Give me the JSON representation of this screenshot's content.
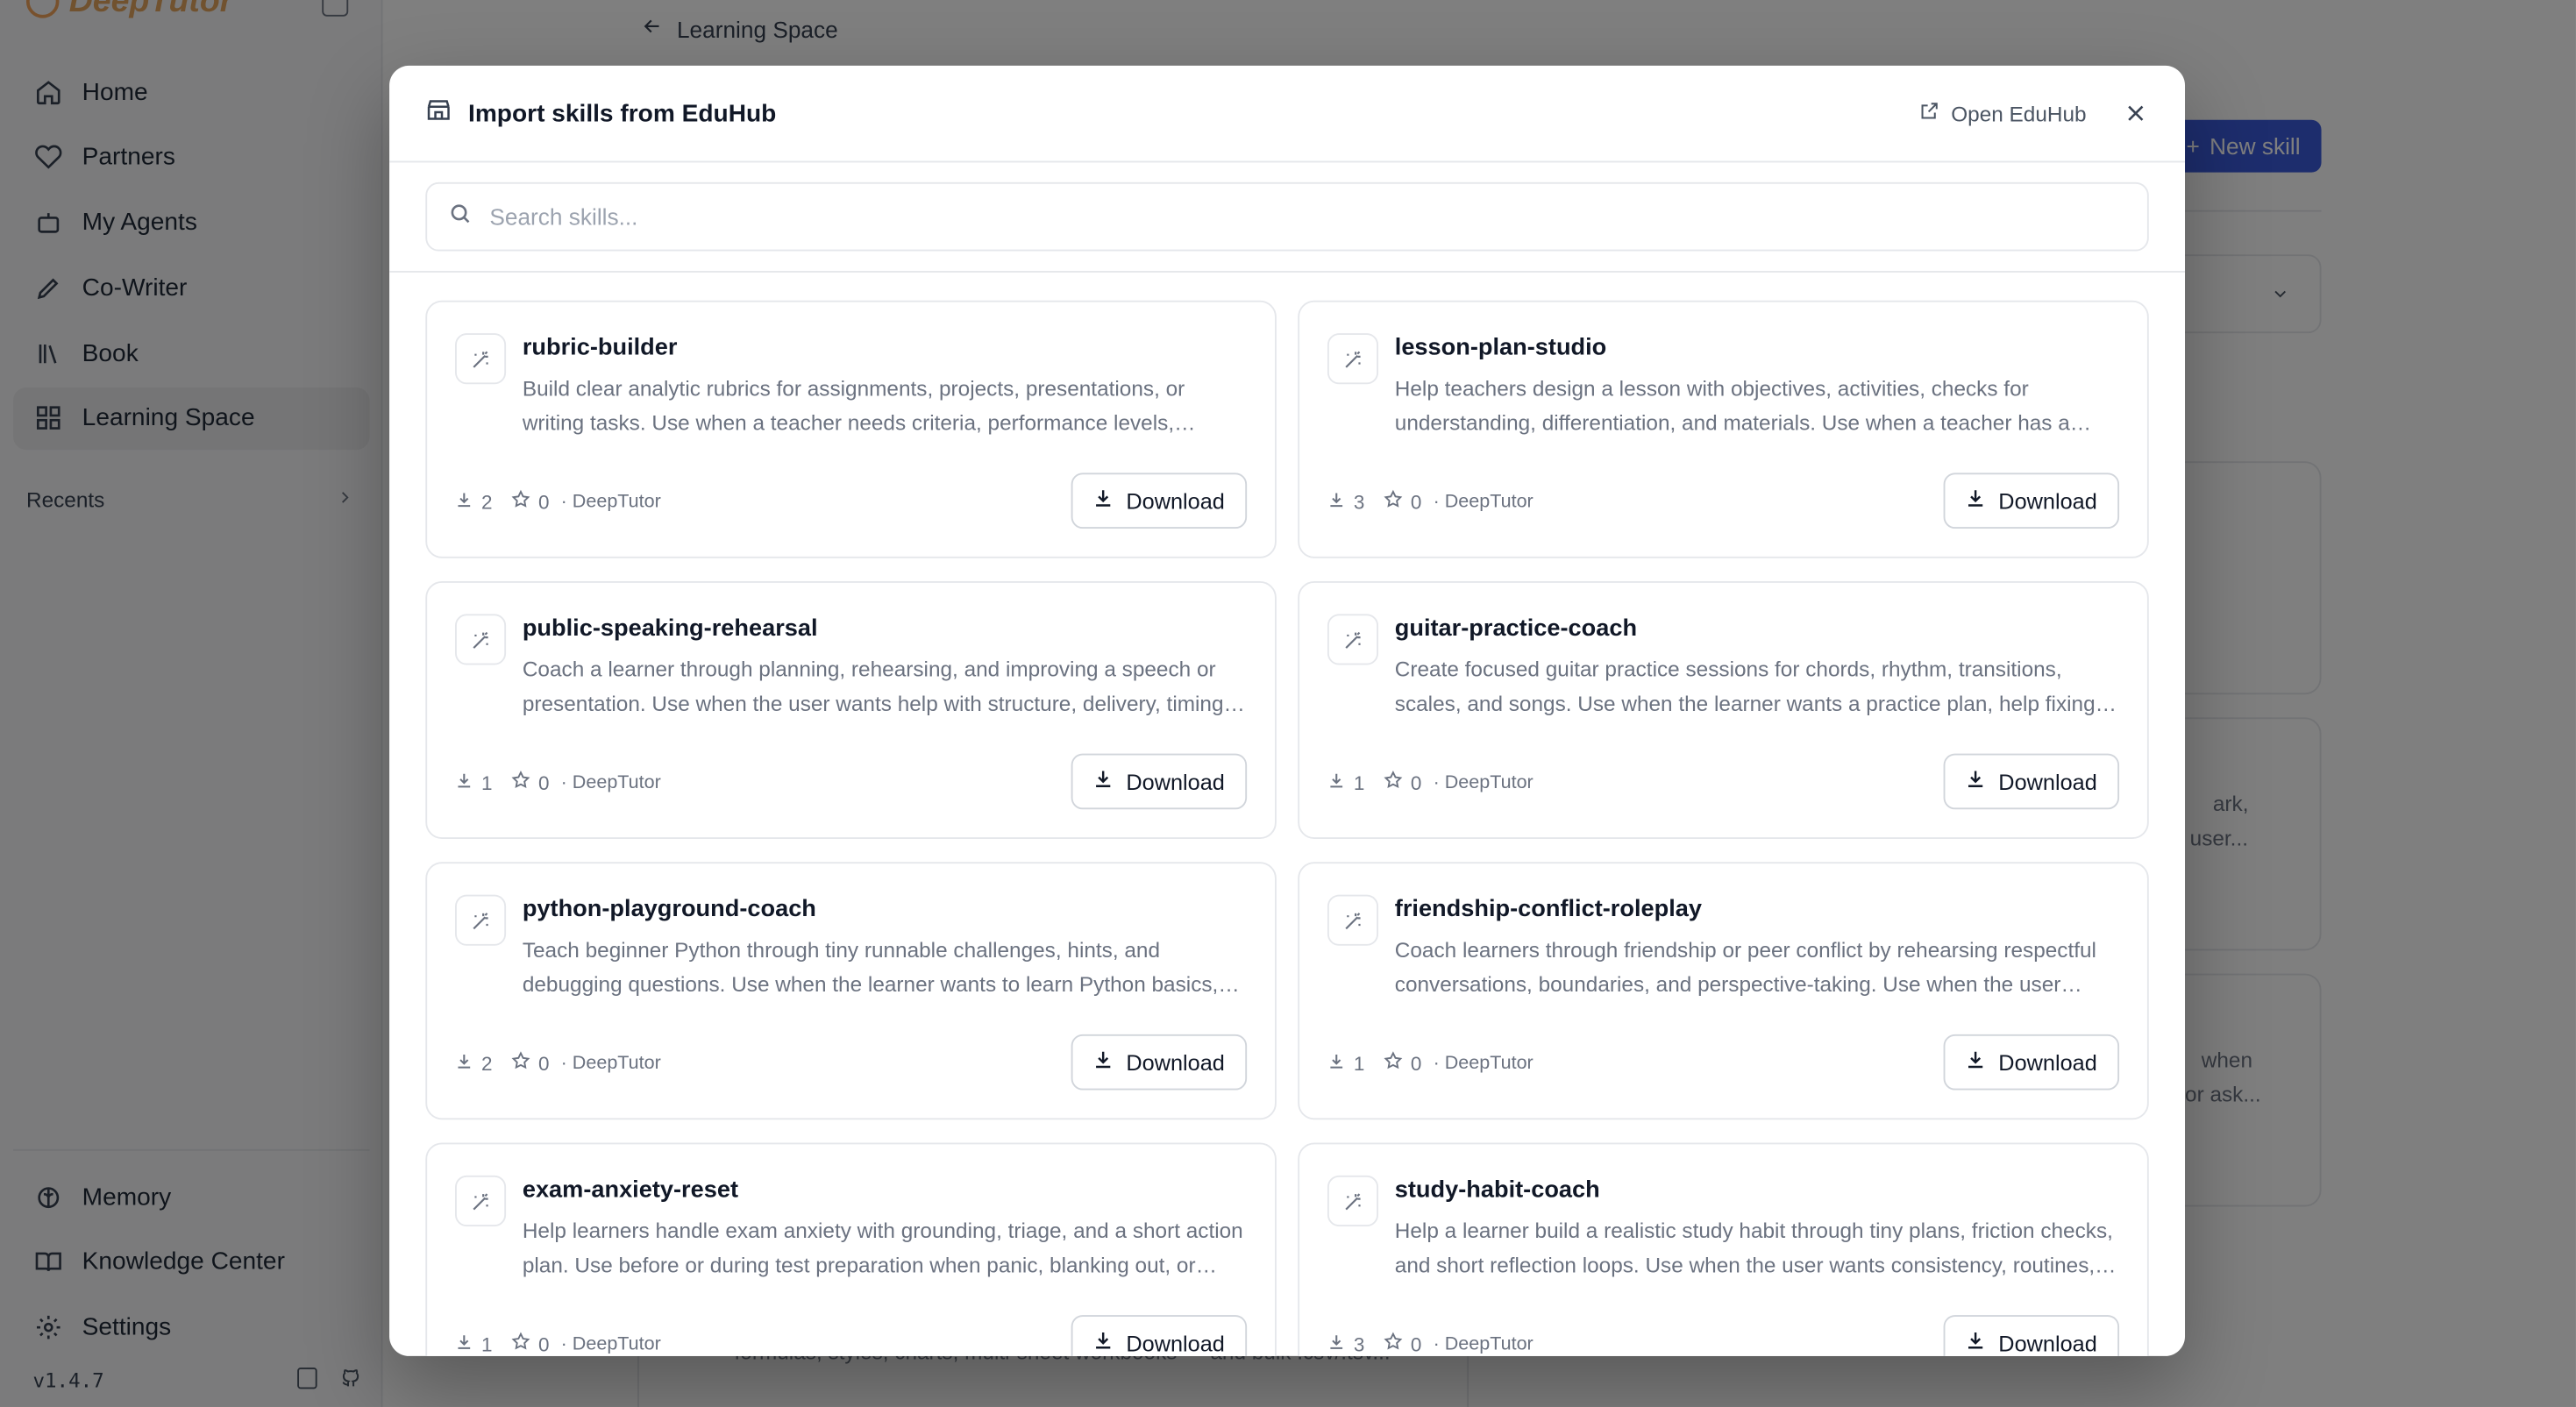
{
  "app": {
    "logo_text": "DeepTutor",
    "version": "v1.4.7"
  },
  "sidebar": {
    "items": [
      {
        "label": "Home",
        "icon": "home-icon"
      },
      {
        "label": "Partners",
        "icon": "heart-handshake-icon"
      },
      {
        "label": "My Agents",
        "icon": "bot-icon"
      },
      {
        "label": "Co-Writer",
        "icon": "pen-icon"
      },
      {
        "label": "Book",
        "icon": "library-icon"
      },
      {
        "label": "Learning Space",
        "icon": "grid-icon",
        "active": true
      }
    ],
    "recents_label": "Recents",
    "bottom_items": [
      {
        "label": "Memory",
        "icon": "brain-icon"
      },
      {
        "label": "Knowledge Center",
        "icon": "book-open-icon"
      },
      {
        "label": "Settings",
        "icon": "gear-icon"
      }
    ]
  },
  "background": {
    "back_label": "Learning Space",
    "new_skill_label": "New skill",
    "snippets": [
      "ark,",
      "user...",
      "when",
      "or ask...",
      "formulas, styles, charts, multi-sheet workbooks — and bulk .csv/.tsv..."
    ]
  },
  "modal": {
    "title": "Import skills from EduHub",
    "open_label": "Open EduHub",
    "search_placeholder": "Search skills...",
    "download_label": "Download",
    "skills": [
      {
        "name": "rubric-builder",
        "description": "Build clear analytic rubrics for assignments, projects, presentations, or writing tasks. Use when a teacher needs criteria, performance levels, scoring guidance, or feedback language.",
        "downloads": "2",
        "stars": "0",
        "author": "· DeepTutor"
      },
      {
        "name": "lesson-plan-studio",
        "description": "Help teachers design a lesson with objectives, activities, checks for understanding, differentiation, and materials. Use when a teacher has a topic and needs a plan.",
        "downloads": "3",
        "stars": "0",
        "author": "· DeepTutor"
      },
      {
        "name": "public-speaking-rehearsal",
        "description": "Coach a learner through planning, rehearsing, and improving a speech or presentation. Use when the user wants help with structure, delivery, timing, or nerves.",
        "downloads": "1",
        "stars": "0",
        "author": "· DeepTutor"
      },
      {
        "name": "guitar-practice-coach",
        "description": "Create focused guitar practice sessions for chords, rhythm, transitions, scales, and songs. Use when the learner wants a practice plan, help fixing a problem, or song practice.",
        "downloads": "1",
        "stars": "0",
        "author": "· DeepTutor"
      },
      {
        "name": "python-playground-coach",
        "description": "Teach beginner Python through tiny runnable challenges, hints, and debugging questions. Use when the learner wants to learn Python basics, practice, or debug code.",
        "downloads": "2",
        "stars": "0",
        "author": "· DeepTutor"
      },
      {
        "name": "friendship-conflict-roleplay",
        "description": "Coach learners through friendship or peer conflict by rehearsing respectful conversations, boundaries, and perspective-taking. Use when the user wants to practice a conversation.",
        "downloads": "1",
        "stars": "0",
        "author": "· DeepTutor"
      },
      {
        "name": "exam-anxiety-reset",
        "description": "Help learners handle exam anxiety with grounding, triage, and a short action plan. Use before or during test preparation when panic, blanking out, or overwhelm shows up.",
        "downloads": "1",
        "stars": "0",
        "author": "· DeepTutor"
      },
      {
        "name": "study-habit-coach",
        "description": "Help a learner build a realistic study habit through tiny plans, friction checks, and short reflection loops. Use when the user wants consistency, routines, or accountability.",
        "downloads": "3",
        "stars": "0",
        "author": "· DeepTutor"
      }
    ]
  },
  "colors": {
    "accent": "#3b5bdb",
    "overlay": "rgba(0,0,0,0.5)"
  }
}
